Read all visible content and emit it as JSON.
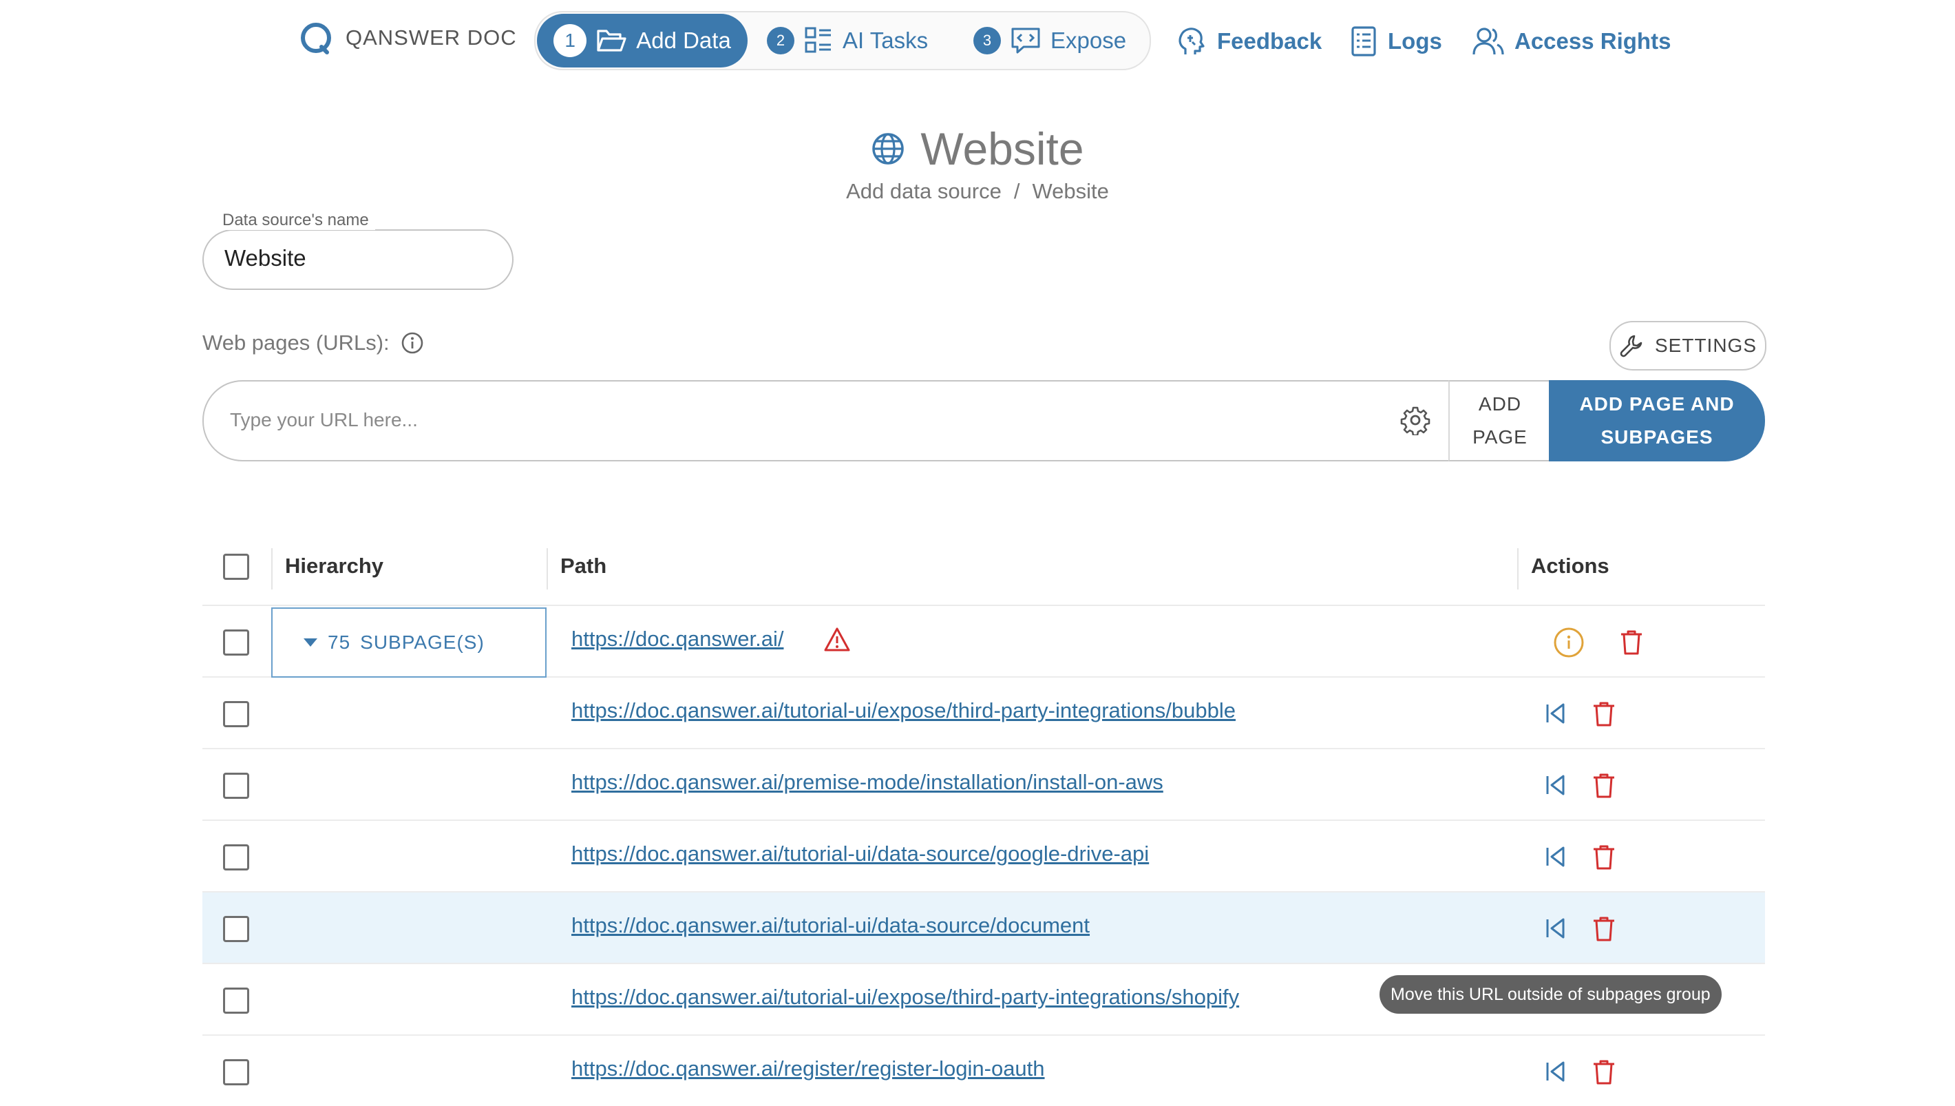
{
  "app": {
    "logo_text": "QANSWER DOC"
  },
  "stepper": [
    {
      "num": "1",
      "label": "Add Data",
      "icon": "folder-open-icon",
      "active": true
    },
    {
      "num": "2",
      "label": "AI Tasks",
      "icon": "tasks-list-icon",
      "active": false
    },
    {
      "num": "3",
      "label": "Expose",
      "icon": "chat-code-icon",
      "active": false
    }
  ],
  "nav": {
    "feedback": "Feedback",
    "logs": "Logs",
    "access_rights": "Access Rights"
  },
  "page": {
    "title": "Website",
    "breadcrumb_parent": "Add data source",
    "breadcrumb_sep": "/",
    "breadcrumb_current": "Website"
  },
  "form": {
    "name_label": "Data source's name",
    "name_value": "Website",
    "webpages_label": "Web pages (URLs):",
    "settings_label": "SETTINGS",
    "url_placeholder": "Type your URL here...",
    "add_page_line1": "ADD",
    "add_page_line2": "PAGE",
    "add_sub_line1": "ADD PAGE AND",
    "add_sub_line2": "SUBPAGES"
  },
  "table": {
    "headers": {
      "hierarchy": "Hierarchy",
      "path": "Path",
      "actions": "Actions"
    },
    "group": {
      "count": "75",
      "label": "SUBPAGE(S)"
    },
    "rows": [
      {
        "url": "https://doc.qanswer.ai/",
        "warning": true
      },
      {
        "url": "https://doc.qanswer.ai/tutorial-ui/expose/third-party-integrations/bubble"
      },
      {
        "url": "https://doc.qanswer.ai/premise-mode/installation/install-on-aws"
      },
      {
        "url": "https://doc.qanswer.ai/tutorial-ui/data-source/google-drive-api"
      },
      {
        "url": "https://doc.qanswer.ai/tutorial-ui/data-source/document"
      },
      {
        "url": "https://doc.qanswer.ai/tutorial-ui/expose/third-party-integrations/shopify"
      },
      {
        "url": "https://doc.qanswer.ai/register/register-login-oauth"
      }
    ]
  },
  "tooltip": "Move this URL outside of subpages group",
  "colors": {
    "primary": "#3c79ad",
    "danger": "#d32f2f",
    "warning_info": "#e0a33a",
    "row_highlight": "#e9f4fb"
  }
}
